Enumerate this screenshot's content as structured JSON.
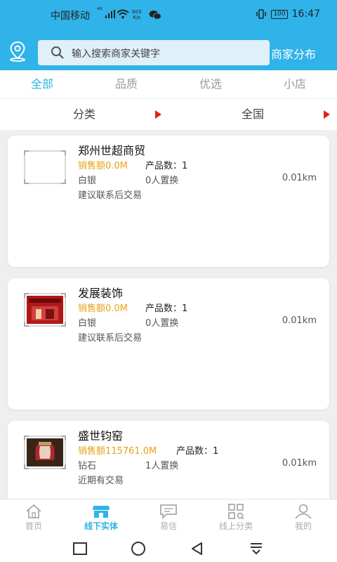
{
  "status_bar": {
    "carrier": "中国移动",
    "signal": "⁴ᴳ",
    "net_speed": "603",
    "net_unit": "K/s",
    "battery": "100",
    "time": "16:47"
  },
  "header": {
    "search_placeholder": "输入搜索商家关键字",
    "distribute_label": "商家分布"
  },
  "tabs": [
    {
      "label": "全部",
      "active": true
    },
    {
      "label": "品质",
      "active": false
    },
    {
      "label": "优选",
      "active": false
    },
    {
      "label": "小店",
      "active": false
    }
  ],
  "filters": [
    {
      "label": "分类"
    },
    {
      "label": "全国"
    }
  ],
  "merchants": [
    {
      "name": "郑州世超商贸",
      "sales": "销售额0.0M",
      "product_count": "产品数：1",
      "level": "白银",
      "exchanges": "0人置换",
      "distance": "0.01km",
      "note": "建议联系后交易",
      "thumb": "blank-frame"
    },
    {
      "name": "发展装饰",
      "sales": "销售额0.0M",
      "product_count": "产品数：1",
      "level": "白银",
      "exchanges": "0人置换",
      "distance": "0.01km",
      "note": "建议联系后交易",
      "thumb": "red-storefront"
    },
    {
      "name": "盛世钧窑",
      "sales": "销售额115761.0M",
      "product_count": "产品数：1",
      "level": "钻石",
      "exchanges": "1人置换",
      "distance": "0.01km",
      "note": "近期有交易",
      "thumb": "porcelain-vase"
    }
  ],
  "bottom_nav": [
    {
      "label": "首页",
      "icon": "home-icon",
      "active": false
    },
    {
      "label": "线下实体",
      "icon": "store-icon",
      "active": true
    },
    {
      "label": "易信",
      "icon": "message-icon",
      "active": false
    },
    {
      "label": "线上分类",
      "icon": "category-icon",
      "active": false
    },
    {
      "label": "我的",
      "icon": "profile-icon",
      "active": false
    }
  ],
  "colors": {
    "brand": "#2fb3e8",
    "sales": "#e8a21a",
    "filter_arrow": "#e02020"
  }
}
